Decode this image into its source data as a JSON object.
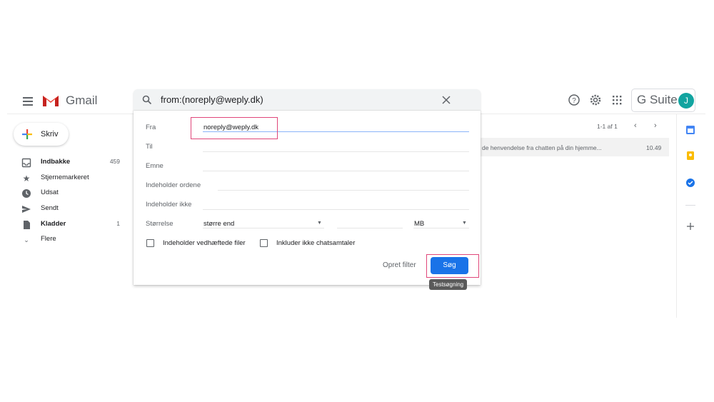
{
  "header": {
    "app_name": "Gmail",
    "search_query": "from:(noreply@weply.dk)",
    "gsuite_label": "G Suite",
    "avatar_letter": "J"
  },
  "sidebar": {
    "compose_label": "Skriv",
    "items": [
      {
        "label": "Indbakke",
        "count": "459",
        "bold": true
      },
      {
        "label": "Stjernemarkeret",
        "count": ""
      },
      {
        "label": "Udsat",
        "count": ""
      },
      {
        "label": "Sendt",
        "count": ""
      },
      {
        "label": "Kladder",
        "count": "1",
        "bold": true
      },
      {
        "label": "Flere",
        "count": ""
      }
    ]
  },
  "list": {
    "pager": "1-1 af 1",
    "email": {
      "snippet": "de henvendelse fra chatten på din hjemme...",
      "time": "10.49"
    }
  },
  "search_panel": {
    "from_label": "Fra",
    "from_value": "noreply@weply.dk",
    "to_label": "Til",
    "subject_label": "Emne",
    "has_words_label": "Indeholder ordene",
    "not_words_label": "Indeholder ikke",
    "size_label": "Størrelse",
    "size_op": "større end",
    "size_unit": "MB",
    "attach_label": "Indeholder vedhæftede filer",
    "no_chats_label": "Inkluder ikke chatsamtaler",
    "create_filter_label": "Opret filter",
    "search_button_label": "Søg",
    "tooltip": "Testsøgning"
  },
  "colors": {
    "accent": "#1a73e8",
    "highlight": "#e0477a",
    "avatar": "#12a4a0"
  }
}
